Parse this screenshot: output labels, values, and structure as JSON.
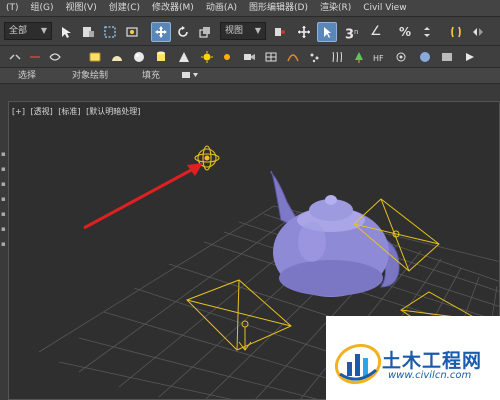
{
  "menu": {
    "items": [
      "(T)",
      "组(G)",
      "视图(V)",
      "创建(C)",
      "修改器(M)",
      "动画(A)",
      "图形编辑器(D)",
      "渲染(R)",
      "Civil View"
    ]
  },
  "toolbar": {
    "selection_set": "全部",
    "reference_coord": "视图",
    "snap_label": "3",
    "angle_label": "∠"
  },
  "ribbon": {
    "tabs": [
      "选择",
      "对象绘制",
      "填充"
    ]
  },
  "viewport": {
    "labels": [
      "[+]",
      "[透视]",
      "[标准]",
      "[默认明暗处理]"
    ]
  },
  "colors": {
    "teapot": "#8e8ad6",
    "light_gizmo": "#e6c21e",
    "arrow": "#e02020",
    "grid": "#555555",
    "brand": "#1a5cab"
  },
  "watermark": {
    "title": "土木工程网",
    "url": "www.civilcn.com"
  }
}
